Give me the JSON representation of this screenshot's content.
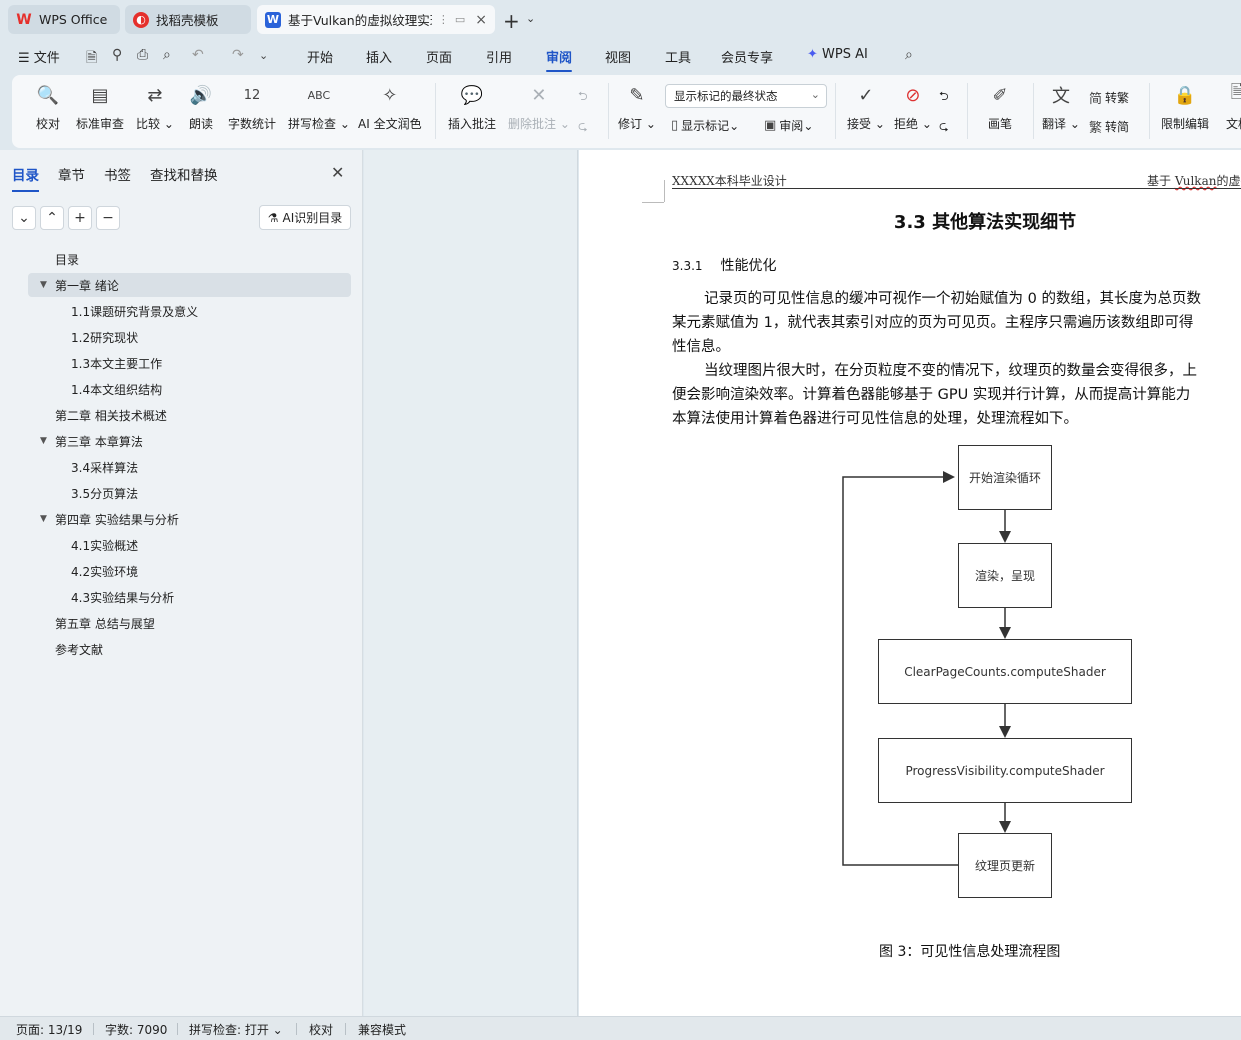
{
  "tabs": [
    {
      "label": "WPS Office",
      "icon": "wps-logo-icon",
      "color": "#e5302c"
    },
    {
      "label": "找稻壳模板",
      "icon": "docer-icon",
      "color": "#e5302c"
    },
    {
      "label": "基于Vulkan的虚拟纹理实现",
      "icon": "word-doc-icon",
      "color": "#2b63d9",
      "extra": "⋮"
    }
  ],
  "menu": {
    "file": "文件",
    "items": [
      "开始",
      "插入",
      "页面",
      "引用",
      "审阅",
      "视图",
      "工具",
      "会员专享"
    ],
    "active": "审阅",
    "wps_ai": "WPS AI"
  },
  "ribbon": {
    "proofread": "校对",
    "std_review": "标准审查",
    "compare": "比较",
    "read_aloud": "朗读",
    "word_count": "字数统计",
    "spell_check": "拼写检查",
    "ai_polish": "AI 全文润色",
    "insert_comment": "插入批注",
    "delete_comment": "删除批注",
    "track_changes": "修订",
    "markup_state": "显示标记的最终状态",
    "show_markup": "显示标记",
    "review_pane": "审阅",
    "accept": "接受",
    "reject": "拒绝",
    "pen": "画笔",
    "translate": "翻译",
    "to_traditional": "转繁",
    "to_simplified": "转简",
    "restrict_edit": "限制编辑",
    "doc_label": "文档"
  },
  "nav": {
    "tabs": [
      "目录",
      "章节",
      "书签",
      "查找和替换"
    ],
    "ai_toc": "AI识别目录",
    "toc": [
      {
        "label": "目录",
        "level": 1,
        "arrow": false,
        "selected": false
      },
      {
        "label": "第一章 绪论",
        "level": 1,
        "arrow": true,
        "selected": true
      },
      {
        "label": "1.1课题研究背景及意义",
        "level": 2,
        "arrow": false,
        "selected": false
      },
      {
        "label": "1.2研究现状",
        "level": 2,
        "arrow": false,
        "selected": false
      },
      {
        "label": "1.3本文主要工作",
        "level": 2,
        "arrow": false,
        "selected": false
      },
      {
        "label": "1.4本文组织结构",
        "level": 2,
        "arrow": false,
        "selected": false
      },
      {
        "label": "第二章 相关技术概述",
        "level": 1,
        "arrow": false,
        "selected": false
      },
      {
        "label": "第三章 本章算法",
        "level": 1,
        "arrow": true,
        "selected": false
      },
      {
        "label": "3.4采样算法",
        "level": 2,
        "arrow": false,
        "selected": false
      },
      {
        "label": "3.5分页算法",
        "level": 2,
        "arrow": false,
        "selected": false
      },
      {
        "label": "第四章 实验结果与分析",
        "level": 1,
        "arrow": true,
        "selected": false
      },
      {
        "label": "4.1实验概述",
        "level": 2,
        "arrow": false,
        "selected": false
      },
      {
        "label": "4.2实验环境",
        "level": 2,
        "arrow": false,
        "selected": false
      },
      {
        "label": "4.3实验结果与分析",
        "level": 2,
        "arrow": false,
        "selected": false
      },
      {
        "label": "第五章 总结与展望",
        "level": 1,
        "arrow": false,
        "selected": false
      },
      {
        "label": "参考文献",
        "level": 1,
        "arrow": false,
        "selected": false
      }
    ]
  },
  "doc": {
    "header_left": "XXXXX本科毕业设计",
    "header_right_prefix": "基于 ",
    "header_right_word": "Vulkan",
    "header_right_suffix": "的虚拟",
    "section_title": "3.3  其他算法实现细节",
    "subsection_num": "3.3.1",
    "subsection_title": "性能优化",
    "paragraphs": [
      "记录页的可见性信息的缓冲可视作一个初始赋值为 0 的数组，其长度为总页数",
      "某元素赋值为 1，就代表其索引对应的页为可见页。主程序只需遍历该数组即可得",
      "性信息。",
      "当纹理图片很大时，在分页粒度不变的情况下，纹理页的数量会变得很多，上",
      "便会影响渲染效率。计算着色器能够基于 GPU 实现并行计算，从而提高计算能力",
      "本算法使用计算着色器进行可见性信息的处理，处理流程如下。"
    ],
    "flow_nodes": [
      "开始渲染循环",
      "渲染，呈现",
      "ClearPageCounts.computeShader",
      "ProgressVisibility.computeShader",
      "纹理页更新"
    ],
    "caption": "图 3：可见性信息处理流程图"
  },
  "status": {
    "page": "页面: 13/19",
    "words": "字数: 7090",
    "spell": "拼写检查: 打开",
    "proof": "校对",
    "compat": "兼容模式"
  }
}
